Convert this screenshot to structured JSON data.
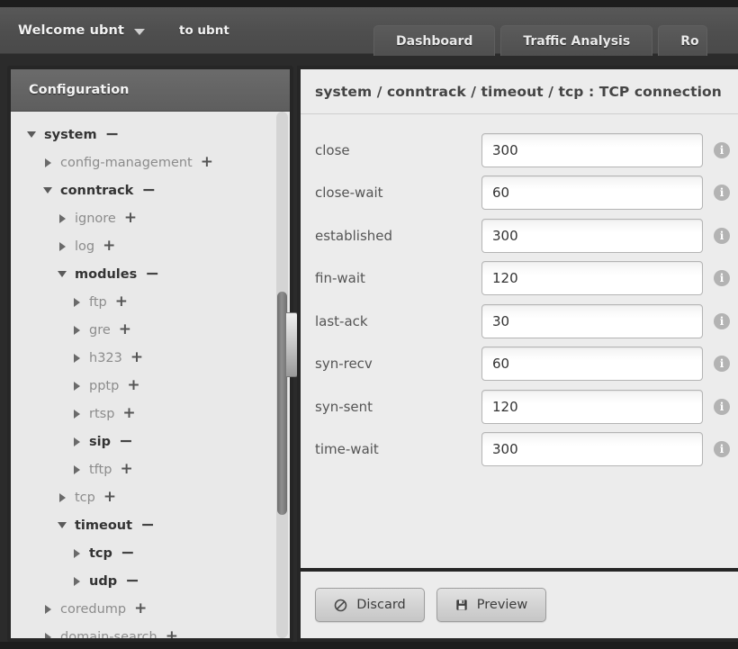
{
  "topbar": {
    "welcome_label": "Welcome ubnt",
    "caret_icon": "chevron-down-icon",
    "to_label": "to ubnt"
  },
  "tabs": [
    {
      "label": "Dashboard",
      "clipped": false
    },
    {
      "label": "Traffic Analysis",
      "clipped": false
    },
    {
      "label": "Ro",
      "clipped": true
    }
  ],
  "sidebar": {
    "title": "Configuration",
    "tree": [
      {
        "label": "system",
        "depth": 0,
        "expanded": true,
        "arrow": "down",
        "toggle": "−"
      },
      {
        "label": "config-management",
        "depth": 1,
        "expanded": false,
        "arrow": "right",
        "toggle": "+"
      },
      {
        "label": "conntrack",
        "depth": 1,
        "expanded": true,
        "arrow": "down",
        "toggle": "−"
      },
      {
        "label": "ignore",
        "depth": 2,
        "expanded": false,
        "arrow": "right",
        "toggle": "+"
      },
      {
        "label": "log",
        "depth": 2,
        "expanded": false,
        "arrow": "right",
        "toggle": "+"
      },
      {
        "label": "modules",
        "depth": 2,
        "expanded": true,
        "arrow": "down",
        "toggle": "−"
      },
      {
        "label": "ftp",
        "depth": 3,
        "expanded": false,
        "arrow": "right",
        "toggle": "+"
      },
      {
        "label": "gre",
        "depth": 3,
        "expanded": false,
        "arrow": "right",
        "toggle": "+"
      },
      {
        "label": "h323",
        "depth": 3,
        "expanded": false,
        "arrow": "right",
        "toggle": "+"
      },
      {
        "label": "pptp",
        "depth": 3,
        "expanded": false,
        "arrow": "right",
        "toggle": "+"
      },
      {
        "label": "rtsp",
        "depth": 3,
        "expanded": false,
        "arrow": "right",
        "toggle": "+"
      },
      {
        "label": "sip",
        "depth": 3,
        "expanded": true,
        "arrow": "right",
        "toggle": "−"
      },
      {
        "label": "tftp",
        "depth": 3,
        "expanded": false,
        "arrow": "right",
        "toggle": "+"
      },
      {
        "label": "tcp",
        "depth": 2,
        "expanded": false,
        "arrow": "right",
        "toggle": "+"
      },
      {
        "label": "timeout",
        "depth": 2,
        "expanded": true,
        "arrow": "down",
        "toggle": "−"
      },
      {
        "label": "tcp",
        "depth": 3,
        "expanded": true,
        "arrow": "right",
        "toggle": "−"
      },
      {
        "label": "udp",
        "depth": 3,
        "expanded": true,
        "arrow": "right",
        "toggle": "−"
      },
      {
        "label": "coredump",
        "depth": 1,
        "expanded": false,
        "arrow": "right",
        "toggle": "+"
      },
      {
        "label": "domain-search",
        "depth": 1,
        "expanded": false,
        "arrow": "right",
        "toggle": "+"
      }
    ]
  },
  "main": {
    "title": "system / conntrack / timeout / tcp : TCP connection",
    "fields": [
      {
        "label": "close",
        "value": "300"
      },
      {
        "label": "close-wait",
        "value": "60"
      },
      {
        "label": "established",
        "value": "300"
      },
      {
        "label": "fin-wait",
        "value": "120"
      },
      {
        "label": "last-ack",
        "value": "30"
      },
      {
        "label": "syn-recv",
        "value": "60"
      },
      {
        "label": "syn-sent",
        "value": "120"
      },
      {
        "label": "time-wait",
        "value": "300"
      }
    ],
    "info_icon_glyph": "i",
    "footer": {
      "discard_label": "Discard",
      "discard_icon": "no-entry-icon",
      "preview_label": "Preview",
      "preview_icon": "floppy-save-icon"
    }
  },
  "colors": {
    "topbar": "#4e4e4e",
    "panel_border": "#262626",
    "panel_bg": "#ececec",
    "sidebar_bg": "#e9e9e9",
    "text_muted": "#8c8c8c",
    "text_strong": "#333333"
  }
}
